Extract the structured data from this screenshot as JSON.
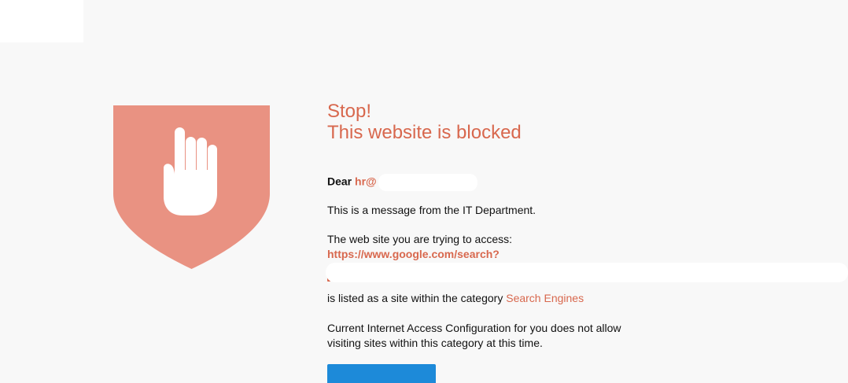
{
  "header": {
    "title_line1": "Stop!",
    "title_line2": "This website is blocked"
  },
  "greeting": {
    "prefix": "Dear",
    "email": "hr@"
  },
  "message": {
    "from_it": "This is a message from the IT Department.",
    "access_intro": "The web site you are trying to access:",
    "url": "https://www.google.com/search?",
    "category_prefix": "is listed as a site within the category",
    "category_name": "Search Engines",
    "config_line1": "Current Internet Access Configuration for you does not allow",
    "config_line2": "visiting sites within this category at this time."
  },
  "icons": {
    "shield": "shield-icon",
    "hand": "hand-stop-icon"
  },
  "colors": {
    "accent": "#d8684e",
    "shield": "#e99282",
    "button": "#1d8ad9",
    "background": "#f8f8f8"
  }
}
